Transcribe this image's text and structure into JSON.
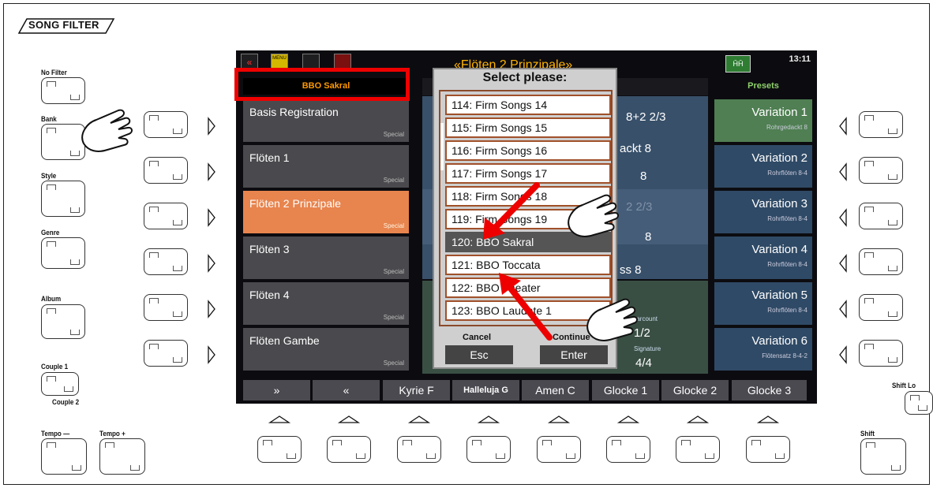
{
  "panel_title": "SONG FILTER",
  "left_labels": {
    "no_filter": "No Filter",
    "bank": "Bank",
    "style": "Style",
    "genre": "Genre",
    "album": "Album",
    "couple1": "Couple 1",
    "couple2": "Couple 2",
    "tempo_minus": "Tempo —",
    "tempo_plus": "Tempo +"
  },
  "right_labels": {
    "shift_lock": "Shift Lo",
    "shift": "Shift"
  },
  "display": {
    "title": "«Flöten 2 Prinzipale»",
    "clock": "13:11",
    "menu_icon": "MENU",
    "preset_icon": "ĤĤ",
    "left_header": "BBO Sakral",
    "right_header": "Presets",
    "list": [
      {
        "name": "Basis Registration",
        "tag": "Special"
      },
      {
        "name": "Flöten 1",
        "tag": "Special"
      },
      {
        "name": "Flöten 2 Prinzipale",
        "tag": "Special"
      },
      {
        "name": "Flöten 3",
        "tag": "Special"
      },
      {
        "name": "Flöten 4",
        "tag": "Special"
      },
      {
        "name": "Flöten Gambe",
        "tag": "Special"
      }
    ],
    "variations": [
      {
        "name": "Variation 1",
        "sub": "Rohrgedackt 8"
      },
      {
        "name": "Variation 2",
        "sub": "Rohrflöten 8-4"
      },
      {
        "name": "Variation 3",
        "sub": "Rohrflöten 8-4"
      },
      {
        "name": "Variation 4",
        "sub": "Rohrflöten 8-4"
      },
      {
        "name": "Variation 5",
        "sub": "Rohrflöten 8-4"
      },
      {
        "name": "Variation 6",
        "sub": "Flötensatz 8-4-2"
      }
    ],
    "mid": {
      "line1": "8+2 2/3",
      "line2": "ackt  8",
      "line3": "8",
      "line4": "2 2/3",
      "line5": "8",
      "line6": "ss   8",
      "barcount_label": "Barcount",
      "barcount": "1/2",
      "signature_label": "Signature",
      "signature": "4/4"
    },
    "softkeys": [
      "»",
      "«",
      "Kyrie F",
      "Halleluja G",
      "Amen  C",
      "Glocke 1",
      "Glocke 2",
      "Glocke 3"
    ]
  },
  "dialog": {
    "title": "Select please:",
    "items": [
      "114: Firm Songs 14",
      "115: Firm Songs 15",
      "116: Firm Songs 16",
      "117: Firm Songs 17",
      "118: Firm Songs 18",
      "119: Firm Songs 19",
      "120: BBO Sakral",
      "121: BBO Toccata",
      "122: BBO Theater",
      "123: BBO Laudate 1"
    ],
    "selected_index": 6,
    "cancel_label": "Cancel",
    "esc_button": "Esc",
    "continue_label": "Continue",
    "enter_button": "Enter"
  },
  "colors": {
    "highlight_red": "#e00000",
    "title_orange": "#ffb300",
    "active_item": "#e8844e",
    "preset_green": "#8fd16b"
  }
}
